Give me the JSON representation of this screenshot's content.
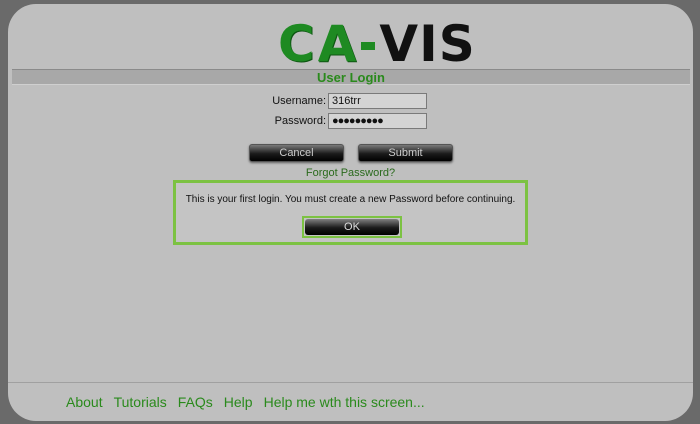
{
  "logo": {
    "part1": "C",
    "part2": "A",
    "part3": "VIS"
  },
  "login": {
    "title": "User Login",
    "username_label": "Username:",
    "username_value": "316trr",
    "password_label": "Password:",
    "password_value": "●●●●●●●●●",
    "cancel_label": "Cancel",
    "submit_label": "Submit",
    "forgot_label": "Forgot Password?"
  },
  "dialog": {
    "message": "This is your first login. You must create a new Password before continuing.",
    "ok_label": "OK"
  },
  "footer": {
    "links": [
      "About",
      "Tutorials",
      "FAQs",
      "Help",
      "Help me wth this screen..."
    ]
  },
  "colors": {
    "accent": "#7cc242",
    "brand_green": "#1e8a22",
    "link_green": "#2a8a1c"
  }
}
